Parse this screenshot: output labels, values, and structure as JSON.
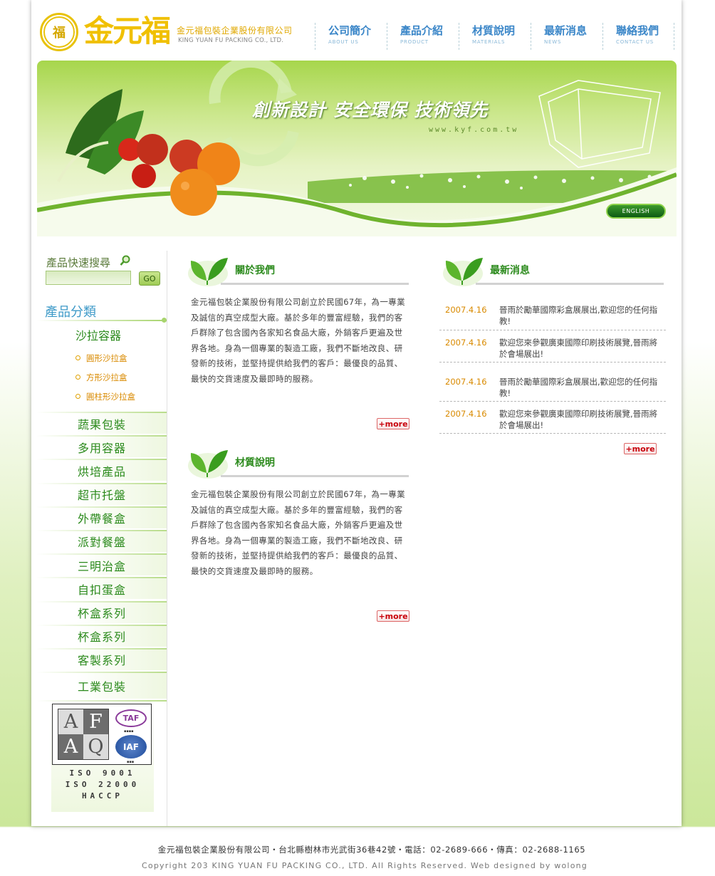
{
  "header": {
    "logo_mark": "金元福",
    "company_name": "金元福包裝企業股份有限公司",
    "company_name_en": "KING YUAN FU PACKING CO., LTD."
  },
  "nav": [
    {
      "zh": "公司簡介",
      "en": "ABOUT US"
    },
    {
      "zh": "產品介紹",
      "en": "PRODUCT"
    },
    {
      "zh": "材質說明",
      "en": "MATERIALS"
    },
    {
      "zh": "最新消息",
      "en": "NEWS"
    },
    {
      "zh": "聯絡我們",
      "en": "CONTACT US"
    }
  ],
  "banner": {
    "slogan": "創新設計  安全環保  技術領先",
    "url": "www.kyf.com.tw",
    "english_button": "ENGLISH"
  },
  "sidebar": {
    "search_title": "產品快速搜尋",
    "search_value": "",
    "search_button": "GO",
    "category_title": "產品分類",
    "current_category": "沙拉容器",
    "subcategories": [
      "圓形沙拉盒",
      "方形沙拉盒",
      "圓柱形沙拉盒"
    ],
    "categories": [
      "蔬果包裝",
      "多用容器",
      "烘培產品",
      "超市托盤",
      "外帶餐盒",
      "派對餐盤",
      "三明治盒",
      "自扣蛋盒",
      "杯盒系列",
      "杯盒系列",
      "客製系列",
      "工業包裝"
    ],
    "cert": {
      "afaq_letters": [
        "AF",
        "AQ"
      ],
      "taf": "TAF",
      "iaf": "IAF",
      "lines": [
        "ISO 9001",
        "ISO 22000",
        "HACCP"
      ]
    }
  },
  "about": {
    "title": "關於我們",
    "text": "金元福包裝企業股份有限公司創立於民國67年，為一專業及誠信的真空成型大廠。基於多年的豐富經驗，我們的客戶群除了包含國內各家知名食品大廠，外銷客戶更遍及世界各地。身為一個專業的製造工廠，我們不斷地改良、研發新的技術，並堅持提供給我們的客戶：最優良的品質、最快的交貨速度及最即時的服務。",
    "more": "+more"
  },
  "materials": {
    "title": "材質說明",
    "text": "金元福包裝企業股份有限公司創立於民國67年，為一專業及誠信的真空成型大廠。基於多年的豐富經驗，我們的客戶群除了包含國內各家知名食品大廠，外銷客戶更遍及世界各地。身為一個專業的製造工廠，我們不斷地改良、研發新的技術，並堅持提供給我們的客戶：最優良的品質、最快的交貨速度及最即時的服務。",
    "more": "+more"
  },
  "news": {
    "title": "最新消息",
    "items": [
      {
        "date": "2007.4.16",
        "text": "晉雨於勵華國際彩盒展展出,歡迎您的任何指教!"
      },
      {
        "date": "2007.4.16",
        "text": "歡迎您來參觀廣東國際印刷技術展覽,晉雨將於會場展出!"
      },
      {
        "date": "2007.4.16",
        "text": "晉雨於勵華國際彩盒展展出,歡迎您的任何指教!"
      },
      {
        "date": "2007.4.16",
        "text": "歡迎您來參觀廣東國際印刷技術展覽,晉雨將於會場展出!"
      }
    ],
    "more": "+more"
  },
  "footer": {
    "address": "金元福包裝企業股份有限公司・台北縣樹林市光武街36巷42號・電話：02-2689-666・傳真：02-2688-1165",
    "copyright": "Copyright 203 KING YUAN FU PACKING CO., LTD. All Rights Reserved. Web designed by wolong"
  },
  "colors": {
    "brand_green": "#2b8a1c",
    "nav_blue": "#3a86c8",
    "accent_orange": "#d98a00",
    "more_red": "#c8000a"
  }
}
